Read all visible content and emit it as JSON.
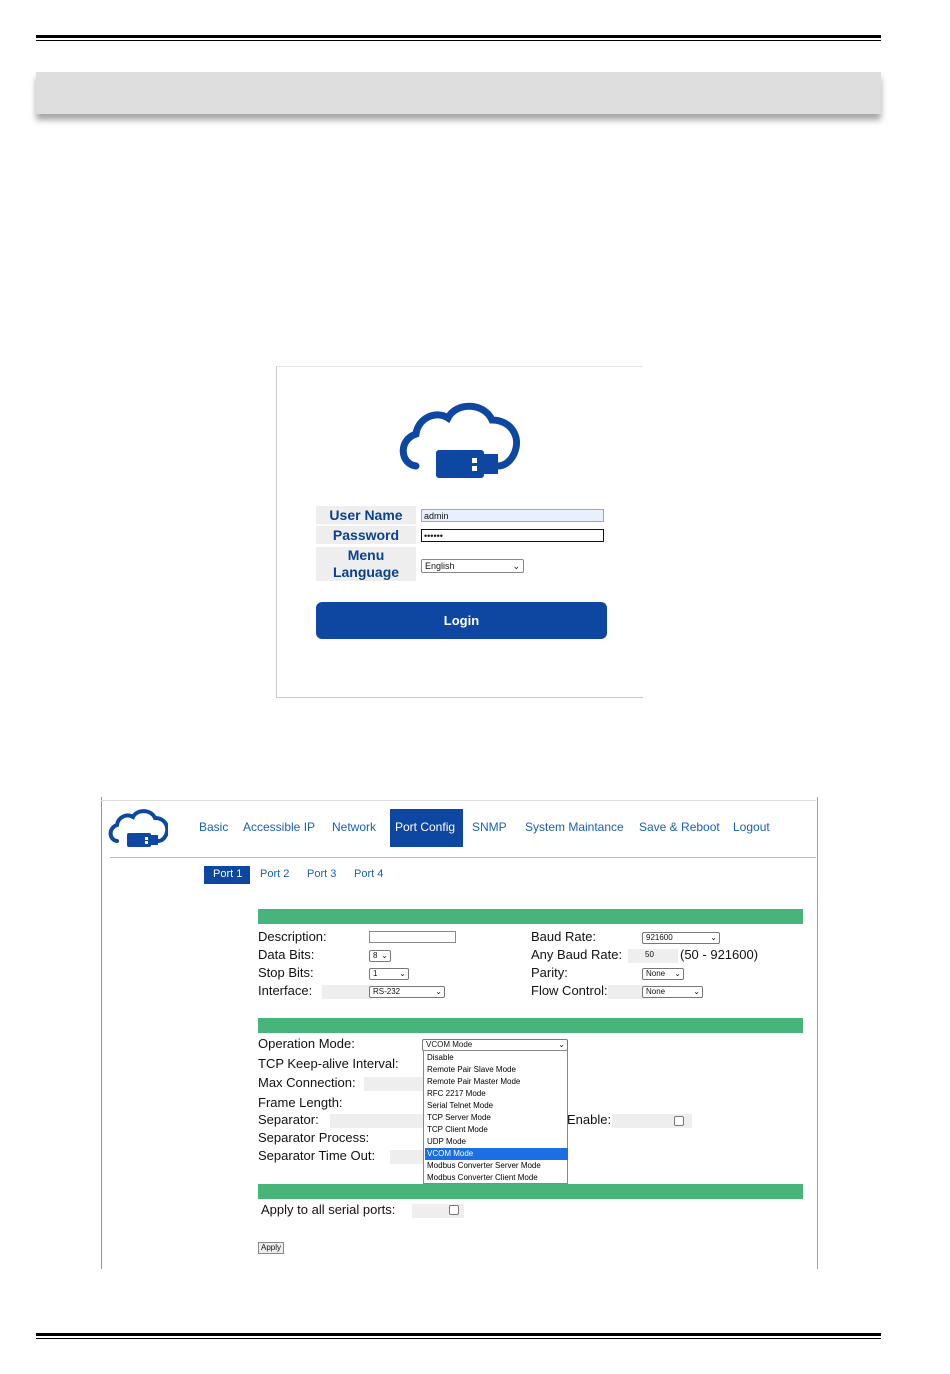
{
  "login": {
    "user_name_label": "User Name",
    "password_label": "Password",
    "menu_label": "Menu",
    "language_label": "Language",
    "user_name_value": "admin",
    "password_value": "••••••",
    "language_value": "English",
    "login_button": "Login",
    "brand_color": "#0e47a1"
  },
  "nav": {
    "items": [
      "Basic",
      "Accessible IP",
      "Network",
      "Port Config",
      "SNMP",
      "System Maintance",
      "Save & Reboot",
      "Logout"
    ],
    "active": "Port Config"
  },
  "ports": {
    "tabs": [
      "Port 1",
      "Port 2",
      "Port 3",
      "Port 4"
    ],
    "active": "Port 1"
  },
  "serial": {
    "description_label": "Description:",
    "description_value": "",
    "data_bits_label": "Data Bits:",
    "data_bits_value": "8",
    "stop_bits_label": "Stop Bits:",
    "stop_bits_value": "1",
    "interface_label": "Interface:",
    "interface_value": "RS-232",
    "baud_rate_label": "Baud Rate:",
    "baud_rate_value": "921600",
    "any_baud_label": "Any Baud Rate:",
    "any_baud_value": "50",
    "any_baud_range": "(50 - 921600)",
    "parity_label": "Parity:",
    "parity_value": "None",
    "flow_label": "Flow Control:",
    "flow_value": "None"
  },
  "operation": {
    "mode_label": "Operation Mode:",
    "mode_value": "VCOM Mode",
    "keepalive_label": "TCP Keep-alive Interval:",
    "max_conn_label": "Max Connection:",
    "frame_len_label": "Frame Length:",
    "separator_label": "Separator:",
    "enable_label": "Enable:",
    "sep_process_label": "Separator Process:",
    "sep_timeout_label": "Separator Time Out:",
    "mode_options": [
      "Disable",
      "Remote Pair Slave Mode",
      "Remote Pair Master Mode",
      "RFC 2217 Mode",
      "Serial Telnet Mode",
      "TCP Server Mode",
      "TCP Client Mode",
      "UDP Mode",
      "VCOM Mode",
      "Modbus Converter Server Mode",
      "Modbus Converter Client Mode"
    ],
    "selected_index": 8
  },
  "apply": {
    "apply_all_label": "Apply to all serial ports:",
    "apply_button": "Apply"
  },
  "colors": {
    "band": "#47b47a",
    "link": "#1a5fb4",
    "select_highlight": "#1b6fe0"
  }
}
